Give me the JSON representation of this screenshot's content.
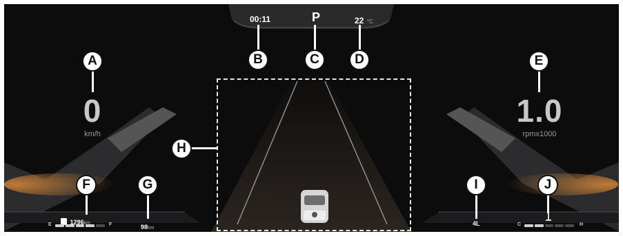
{
  "top_bar": {
    "time": "00:11",
    "gear": "P",
    "temperature": "22",
    "temperature_unit": "°C"
  },
  "speed": {
    "value": "0",
    "unit": "km/h"
  },
  "tachometer": {
    "value": "1.0",
    "unit": "rpmx1000"
  },
  "fuel": {
    "range_value": "1296",
    "range_unit": "km",
    "empty_label": "E",
    "full_label": "F",
    "level_fraction": 0.8
  },
  "trip": {
    "value": "98",
    "unit": "km"
  },
  "drive_mode": {
    "label": "4L"
  },
  "coolant": {
    "cold_label": "C",
    "hot_label": "H",
    "level_fraction": 0.45
  },
  "callouts": {
    "A": "A",
    "B": "B",
    "C": "C",
    "D": "D",
    "E": "E",
    "F": "F",
    "G": "G",
    "H": "H",
    "I": "I",
    "J": "J"
  },
  "colors": {
    "background": "#0c0c0d",
    "accent_amber": "#d98a3a",
    "callout_fill": "#ffffff"
  }
}
